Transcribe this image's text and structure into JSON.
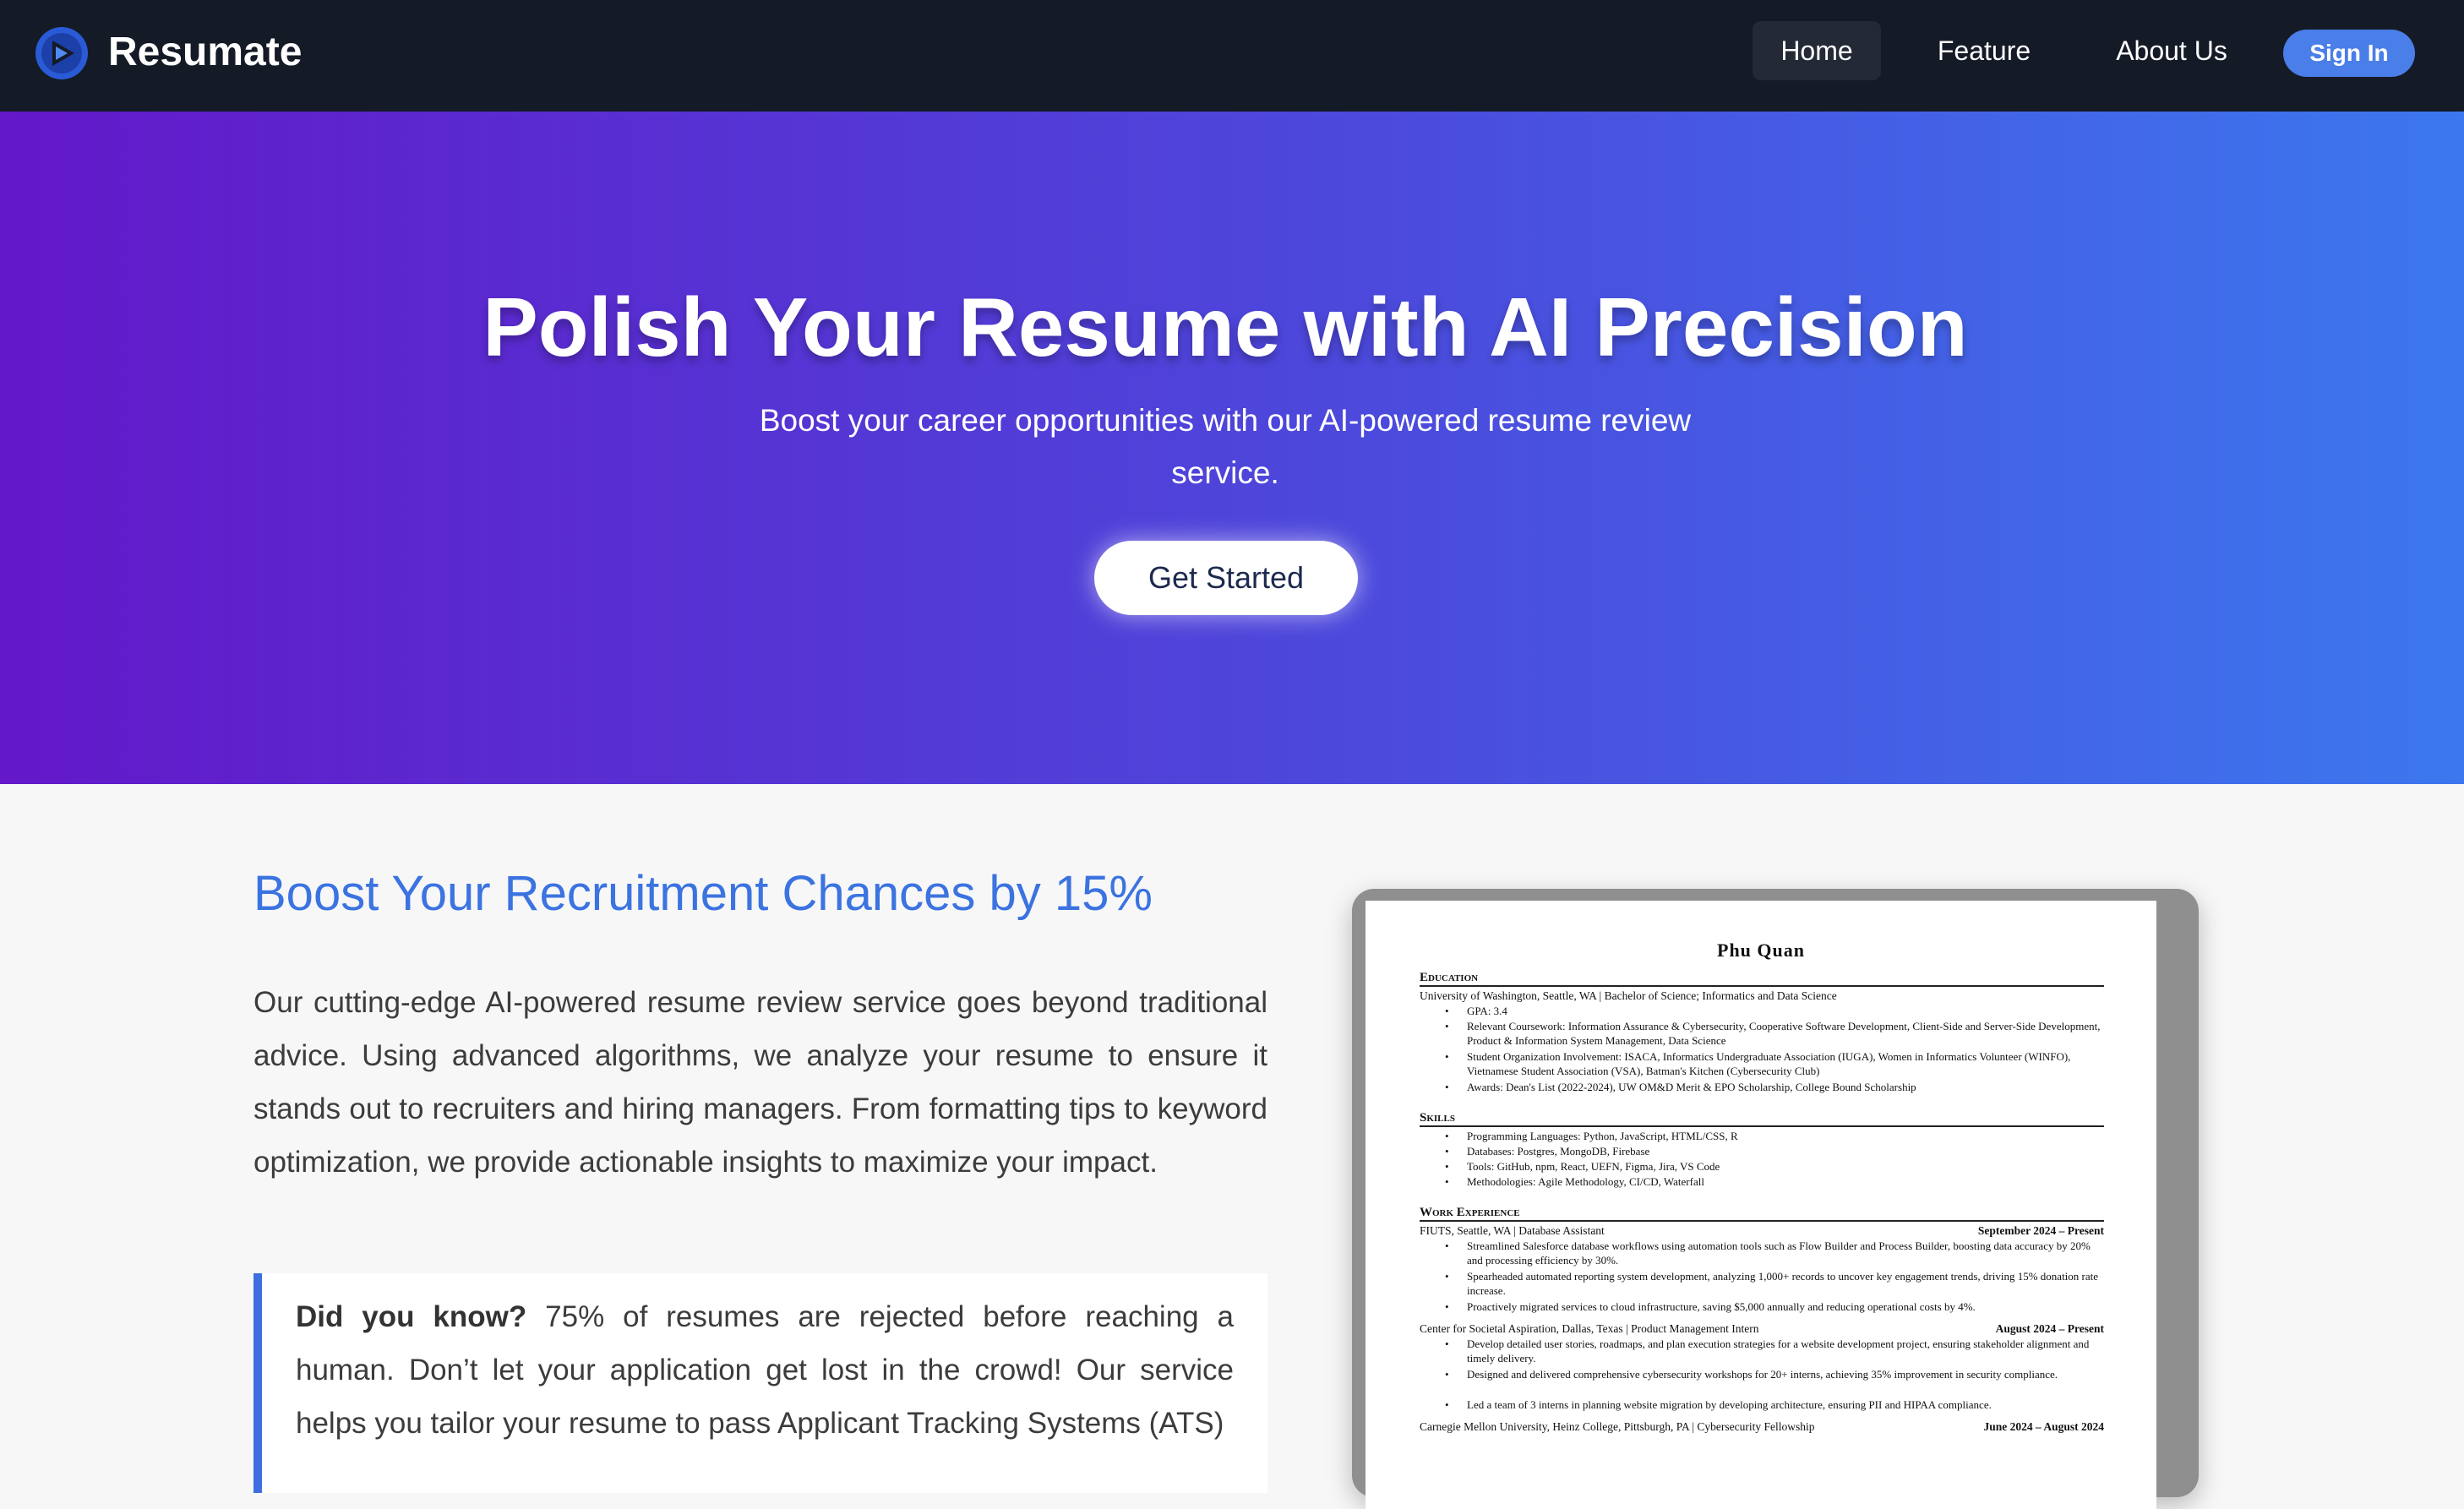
{
  "nav": {
    "brand": "Resumate",
    "links": [
      "Home",
      "Feature",
      "About Us"
    ],
    "signin": "Sign In",
    "colors": {
      "bar": "#141a26",
      "active": "#232a36",
      "signin": "#4a7ee8"
    }
  },
  "hero": {
    "title": "Polish Your Resume with AI Precision",
    "subtitle": "Boost your career opportunities with our AI-powered resume review service.",
    "cta": "Get Started"
  },
  "content": {
    "title": "Boost Your Recruitment Chances by 15%",
    "paragraph": "Our cutting-edge AI-powered resume review service goes beyond traditional advice. Using advanced algorithms, we analyze your resume to ensure it stands out to recruiters and hiring managers. From formatting tips to keyword optimization, we provide actionable insights to maximize your impact.",
    "callout_lead": "Did you know?",
    "callout_text": " 75% of resumes are rejected before reaching a human. Don’t let your application get lost in the crowd! Our service helps you tailor your resume to pass Applicant Tracking Systems (ATS)"
  },
  "resume": {
    "name": "Phu Quan",
    "education_header": "Education",
    "edu_line": "University of Washington, Seattle, WA | Bachelor of Science; Informatics and Data Science",
    "edu_bullets": [
      "GPA: 3.4",
      "Relevant Coursework: Information Assurance & Cybersecurity, Cooperative Software Development, Client-Side and Server-Side Development, Product & Information System Management, Data Science",
      "Student Organization Involvement: ISACA, Informatics Undergraduate Association (IUGA), Women in Informatics Volunteer (WINFO), Vietnamese Student Association (VSA), Batman's Kitchen (Cybersecurity Club)",
      "Awards: Dean's List (2022-2024), UW OM&D Merit & EPO Scholarship, College Bound Scholarship"
    ],
    "skills_header": "Skills",
    "skills": [
      "Programming Languages: Python, JavaScript, HTML/CSS, R",
      "Databases: Postgres, MongoDB, Firebase",
      "Tools: GitHub, npm, React, UEFN, Figma, Jira, VS Code",
      "Methodologies: Agile Methodology, CI/CD, Waterfall"
    ],
    "work_header": "Work Experience",
    "job1": "FIUTS, Seattle, WA | Database Assistant",
    "job1_date": "September 2024 – Present",
    "job1_bullets": [
      "Streamlined Salesforce database workflows using automation tools such as Flow Builder and Process Builder, boosting data accuracy by 20% and processing efficiency by 30%.",
      "Spearheaded automated reporting system development, analyzing 1,000+ records to uncover key engagement trends, driving 15% donation rate increase.",
      "Proactively migrated services to cloud infrastructure, saving $5,000 annually and reducing operational costs by 4%."
    ],
    "job2": "Center for Societal Aspiration, Dallas, Texas | Product Management Intern",
    "job2_date": "August 2024 – Present",
    "job2_bullets": [
      "Develop detailed user stories, roadmaps, and plan execution strategies for a website development project, ensuring stakeholder alignment and timely delivery.",
      "Designed and delivered comprehensive cybersecurity workshops for 20+ interns, achieving 35% improvement in security compliance.",
      "Led a team of 3 interns in planning website migration by developing architecture, ensuring PII and HIPAA compliance."
    ],
    "job3": "Carnegie Mellon University, Heinz College, Pittsburgh, PA | Cybersecurity Fellowship",
    "job3_date": "June 2024 – August 2024"
  }
}
